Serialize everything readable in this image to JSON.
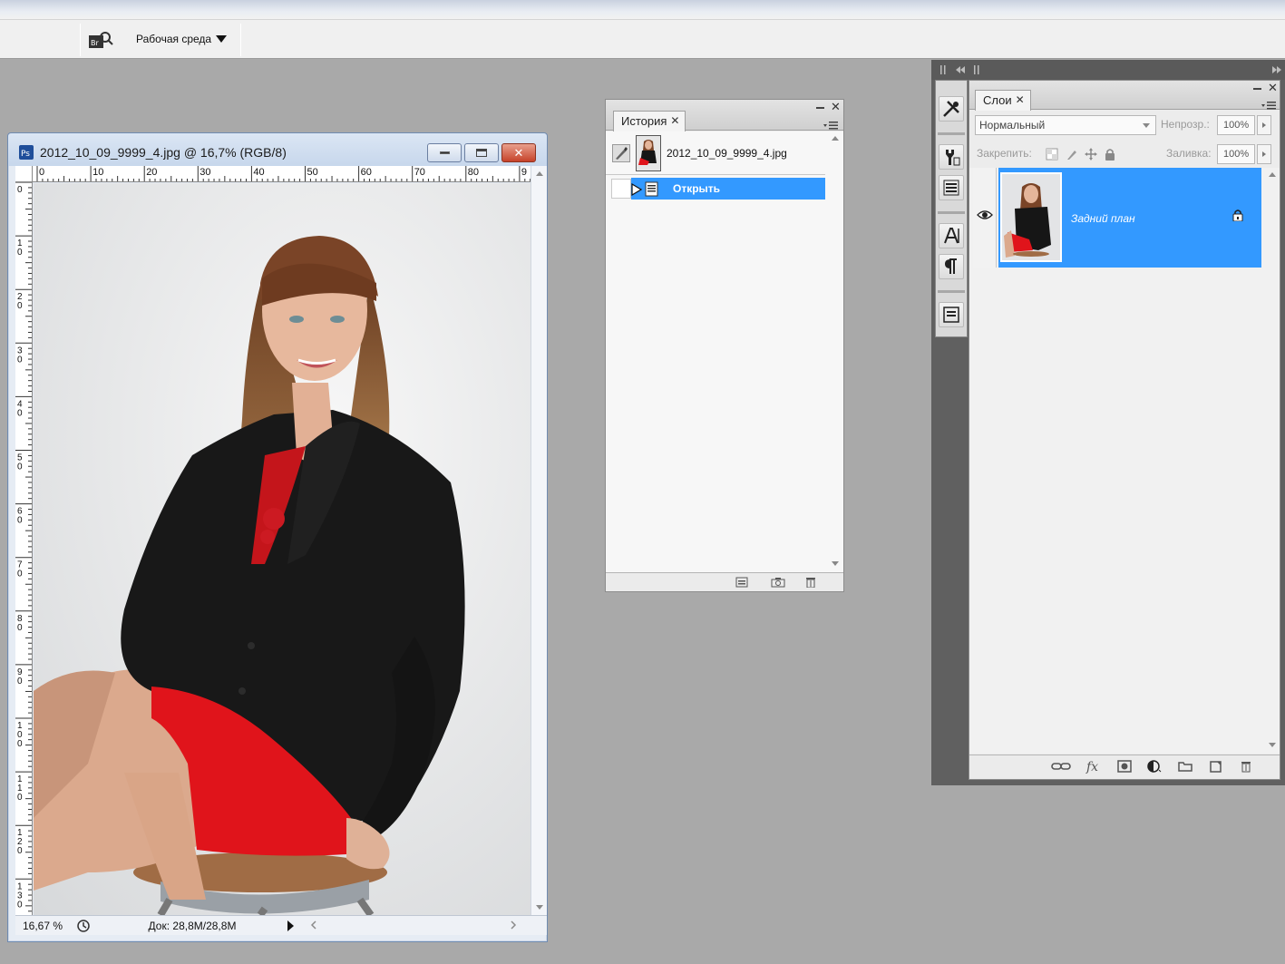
{
  "toolbar": {
    "workspace_label": "Рабочая среда"
  },
  "document": {
    "title": "2012_10_09_9999_4.jpg @ 16,7% (RGB/8)",
    "ruler_top_labels": [
      "0",
      "10",
      "20",
      "30",
      "40",
      "50",
      "60",
      "70",
      "80",
      "9"
    ],
    "ruler_left_labels": [
      "0",
      "10",
      "20",
      "30",
      "40",
      "50",
      "60",
      "70",
      "80",
      "90",
      "100",
      "110",
      "120",
      "130"
    ],
    "zoom": "16,67 %",
    "doc_info": "Док: 28,8M/28,8M"
  },
  "history": {
    "tab_label": "История",
    "snapshot_name": "2012_10_09_9999_4.jpg",
    "states": [
      {
        "label": "Открыть",
        "selected": true
      }
    ]
  },
  "layers": {
    "tab_label": "Слои",
    "blend_mode": "Нормальный",
    "opacity_label": "Непрозр.:",
    "opacity_value": "100%",
    "lock_label": "Закрепить:",
    "fill_label": "Заливка:",
    "fill_value": "100%",
    "items": [
      {
        "name": "Задний план",
        "visible": true,
        "locked": true,
        "selected": true
      }
    ],
    "footer_fx_label": "fx"
  },
  "colors": {
    "selection": "#3399ff",
    "workspace_bg": "#a9a9a9",
    "jacket": "#161616",
    "skirt": "#e0141b",
    "hair": "#7b4a2a",
    "skin": "#e4b59a"
  }
}
